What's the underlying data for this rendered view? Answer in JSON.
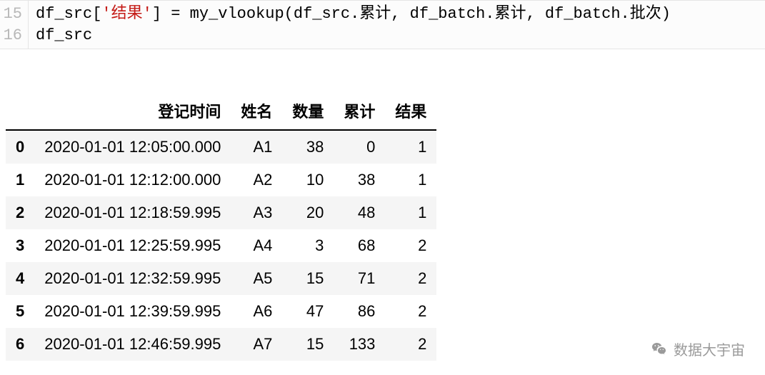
{
  "code": {
    "line_numbers": [
      "15",
      "16"
    ],
    "line15_pre": "df_src[",
    "line15_str": "'结果'",
    "line15_post": "] = my_vlookup(df_src.累计, df_batch.累计, df_batch.批次)",
    "line16": "df_src"
  },
  "table": {
    "columns": [
      "登记时间",
      "姓名",
      "数量",
      "累计",
      "结果"
    ],
    "rows": [
      {
        "idx": "0",
        "time": "2020-01-01 12:05:00.000",
        "name": "A1",
        "qty": "38",
        "cum": "0",
        "res": "1"
      },
      {
        "idx": "1",
        "time": "2020-01-01 12:12:00.000",
        "name": "A2",
        "qty": "10",
        "cum": "38",
        "res": "1"
      },
      {
        "idx": "2",
        "time": "2020-01-01 12:18:59.995",
        "name": "A3",
        "qty": "20",
        "cum": "48",
        "res": "1"
      },
      {
        "idx": "3",
        "time": "2020-01-01 12:25:59.995",
        "name": "A4",
        "qty": "3",
        "cum": "68",
        "res": "2"
      },
      {
        "idx": "4",
        "time": "2020-01-01 12:32:59.995",
        "name": "A5",
        "qty": "15",
        "cum": "71",
        "res": "2"
      },
      {
        "idx": "5",
        "time": "2020-01-01 12:39:59.995",
        "name": "A6",
        "qty": "47",
        "cum": "86",
        "res": "2"
      },
      {
        "idx": "6",
        "time": "2020-01-01 12:46:59.995",
        "name": "A7",
        "qty": "15",
        "cum": "133",
        "res": "2"
      }
    ]
  },
  "watermark": {
    "text": "数据大宇宙"
  }
}
